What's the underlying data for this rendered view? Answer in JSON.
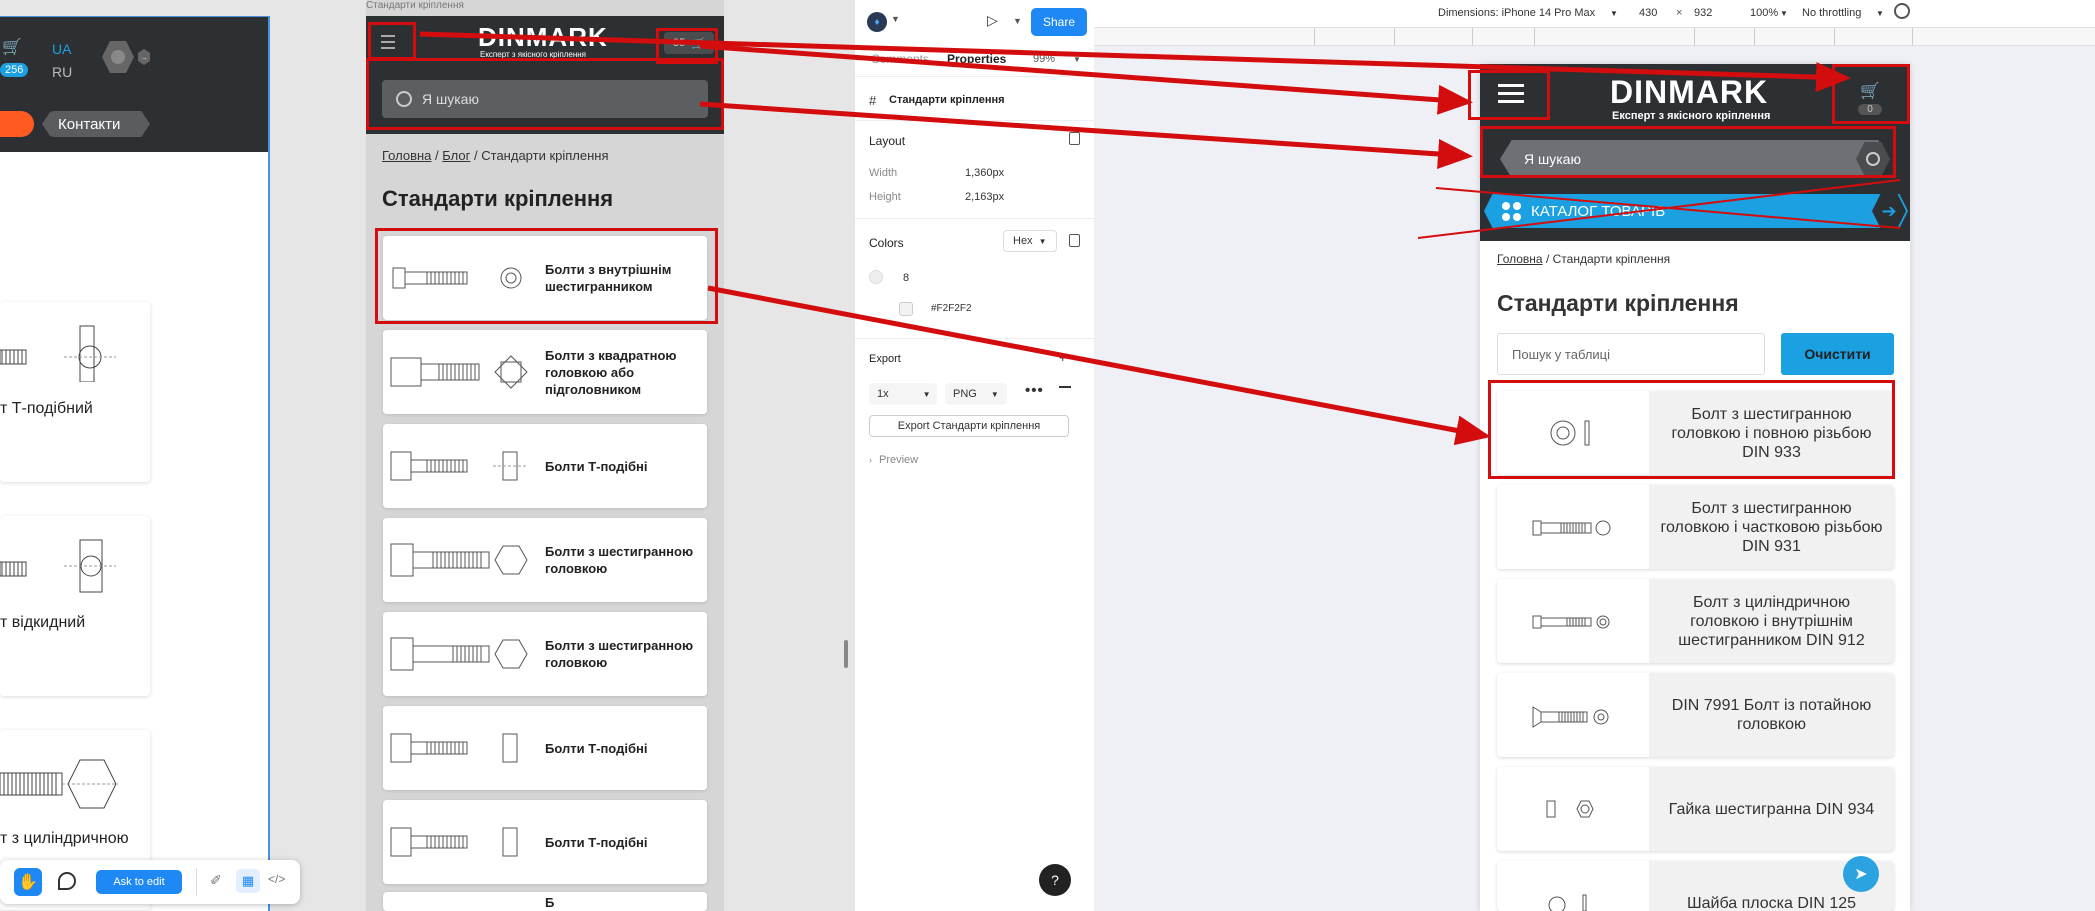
{
  "left_canvas": {
    "cart_count": "256",
    "lang_ua": "UA",
    "lang_ru": "RU",
    "contacts_tab": "Контакти",
    "cards": [
      {
        "label": "т Т-подібний"
      },
      {
        "label": "т відкидний"
      },
      {
        "label": "т з циліндричною"
      }
    ]
  },
  "bottom_toolbar": {
    "ask_to_edit": "Ask to edit"
  },
  "mobile_mock": {
    "frame_title": "Стандарти кріплення",
    "logo": "DINMARK",
    "tagline": "Експерт з якісного кріплення",
    "cart_count": "35",
    "search_placeholder": "Я шукаю",
    "breadcrumb": {
      "home": "Головна",
      "sep1": "/",
      "blog": "Блог",
      "sep2": "/",
      "current": "Стандарти кріплення"
    },
    "page_title": "Стандарти кріплення",
    "items": [
      {
        "label": "Болти з внутрішнім шестигранником"
      },
      {
        "label": "Болти з квадратною головкою або підголовником"
      },
      {
        "label": "Болти Т-подібні"
      },
      {
        "label": "Болти з шестигранною головкою"
      },
      {
        "label": "Болти з шестигранною головкою"
      },
      {
        "label": "Болти Т-подібні"
      },
      {
        "label": "Болти Т-подібні"
      },
      {
        "label": "Б"
      }
    ]
  },
  "properties_panel": {
    "tab_comments": "Comments",
    "tab_properties": "Properties",
    "zoom": "99%",
    "share_label": "Share",
    "frame_name": "Стандарти кріплення",
    "layout_title": "Layout",
    "width_label": "Width",
    "width_value": "1,360px",
    "height_label": "Height",
    "height_value": "2,163px",
    "colors_title": "Colors",
    "color_format": "Hex",
    "color_count": "8",
    "color_hex": "#F2F2F2",
    "color_swatch": "#F2F2F2",
    "export_title": "Export",
    "export_scale": "1x",
    "export_format": "PNG",
    "export_button": "Export Стандарти кріплення",
    "preview_label": "Preview",
    "help_label": "?"
  },
  "device_toolbar": {
    "dimensions_label": "Dimensions: iPhone 14 Pro Max",
    "width": "430",
    "x": "×",
    "height": "932",
    "zoom": "100%",
    "throttle": "No throttling"
  },
  "phone": {
    "logo": "DINMARK",
    "tagline": "Експерт з якісного кріплення",
    "cart_count": "0",
    "search_placeholder": "Я шукаю",
    "catalog_label": "КАТАЛОГ ТОВАРІВ",
    "breadcrumb": {
      "home": "Головна",
      "sep": "/",
      "current": "Стандарти кріплення"
    },
    "page_title": "Стандарти кріплення",
    "table_search_placeholder": "Пошук у таблиці",
    "clear_button": "Очистити",
    "items": [
      {
        "label": "Болт з шестигранною головкою і повною різьбою DIN 933"
      },
      {
        "label": "Болт з шестигранною головкою і частковою різьбою DIN 931"
      },
      {
        "label": "Болт з циліндричною головкою і внутрішнім шестигранником DIN 912"
      },
      {
        "label": "DIN 7991 Болт із потайною головкою"
      },
      {
        "label": "Гайка шестигранна DIN 934"
      },
      {
        "label": "Шайба плоска DIN 125"
      }
    ]
  },
  "colors": {
    "accent_blue": "#1ba0e2",
    "dark_header": "#2d3033",
    "annotation_red": "#d30d0d",
    "orange": "#ff5a1f"
  }
}
